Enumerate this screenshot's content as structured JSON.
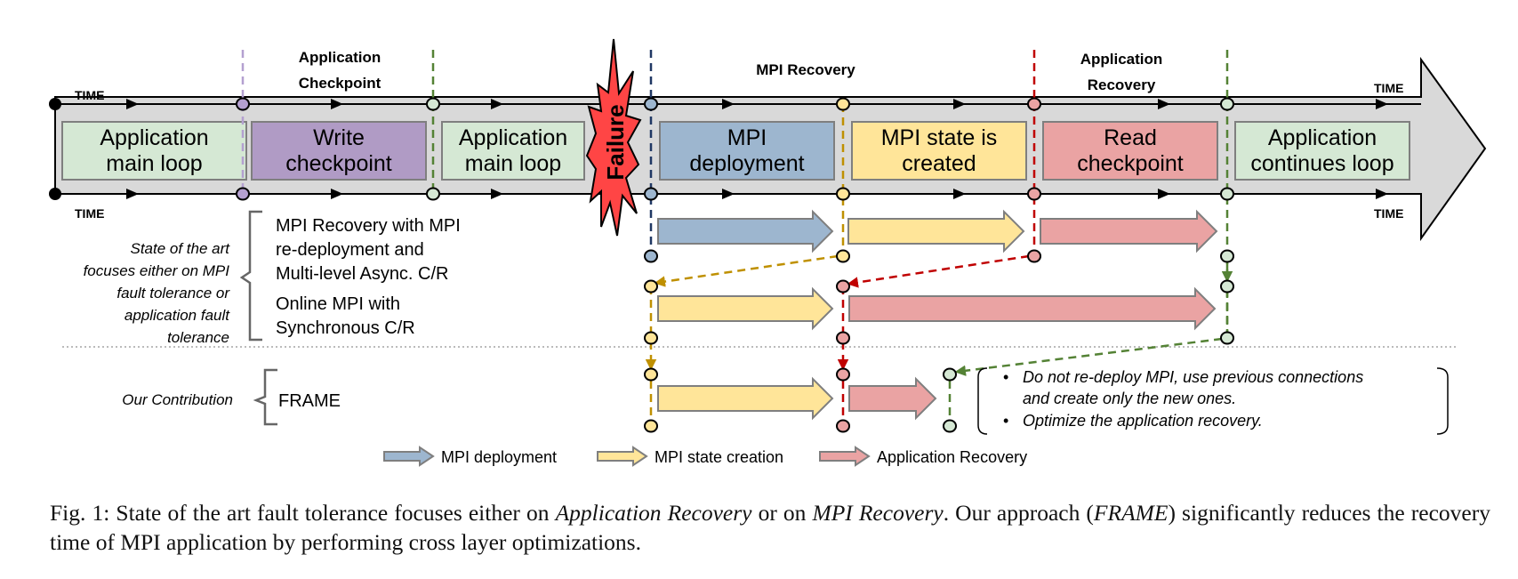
{
  "timeline": {
    "time_label": "TIME",
    "phase_headers": {
      "checkpoint": [
        "Application",
        "Checkpoint"
      ],
      "mpi_recovery": [
        "MPI Recovery"
      ],
      "app_recovery": [
        "Application",
        "Recovery"
      ]
    },
    "failure_label": "Failure",
    "boxes": [
      {
        "id": "app-main-loop-1",
        "lines": [
          "Application",
          "main loop"
        ],
        "fill": "#d5e8d4"
      },
      {
        "id": "write-checkpoint",
        "lines": [
          "Write",
          "checkpoint"
        ],
        "fill": "#b09bc5"
      },
      {
        "id": "app-main-loop-2",
        "lines": [
          "Application",
          "main loop"
        ],
        "fill": "#d5e8d4"
      },
      {
        "id": "mpi-deployment",
        "lines": [
          "MPI",
          "deployment"
        ],
        "fill": "#9db6cf"
      },
      {
        "id": "mpi-state-created",
        "lines": [
          "MPI state is",
          "created"
        ],
        "fill": "#ffe599"
      },
      {
        "id": "read-checkpoint",
        "lines": [
          "Read",
          "checkpoint"
        ],
        "fill": "#eaa3a3"
      },
      {
        "id": "app-continues-loop",
        "lines": [
          "Application",
          "continues loop"
        ],
        "fill": "#d5e8d4"
      }
    ]
  },
  "state_of_art": {
    "label_lines": [
      "State of the art",
      "focuses either on MPI",
      "fault tolerance or",
      "application fault",
      "tolerance"
    ],
    "approaches": [
      {
        "lines": [
          "MPI Recovery with MPI",
          "re-deployment and",
          "Multi-level Async. C/R"
        ]
      },
      {
        "lines": [
          "Online MPI with",
          "Synchronous C/R"
        ]
      }
    ]
  },
  "contribution": {
    "label": "Our Contribution",
    "name": "FRAME",
    "notes": [
      [
        "Do not re-deploy MPI, use previous connections",
        "and create only the new ones."
      ],
      [
        "Optimize the application recovery."
      ]
    ]
  },
  "legend": [
    {
      "label": "MPI deployment",
      "color": "#9db6cf"
    },
    {
      "label": "MPI state creation",
      "color": "#ffe599"
    },
    {
      "label": "Application Recovery",
      "color": "#eaa3a3"
    }
  ],
  "colors": {
    "mpi_deploy": "#9db6cf",
    "mpi_state": "#ffe599",
    "app_recovery": "#eaa3a3",
    "app_loop": "#d5e8d4",
    "checkpoint": "#b09bc5",
    "failure": "#ff4040",
    "band": "#d9d9d9"
  },
  "caption": {
    "prefix": "Fig. 1: State of the art fault tolerance focuses either on ",
    "em1": "Application Recovery",
    "mid1": " or on ",
    "em2": "MPI Recovery",
    "mid2": ". Our approach (",
    "em3": "FRAME",
    "suffix": ") significantly reduces the recovery time of MPI application by performing cross layer optimizations."
  }
}
